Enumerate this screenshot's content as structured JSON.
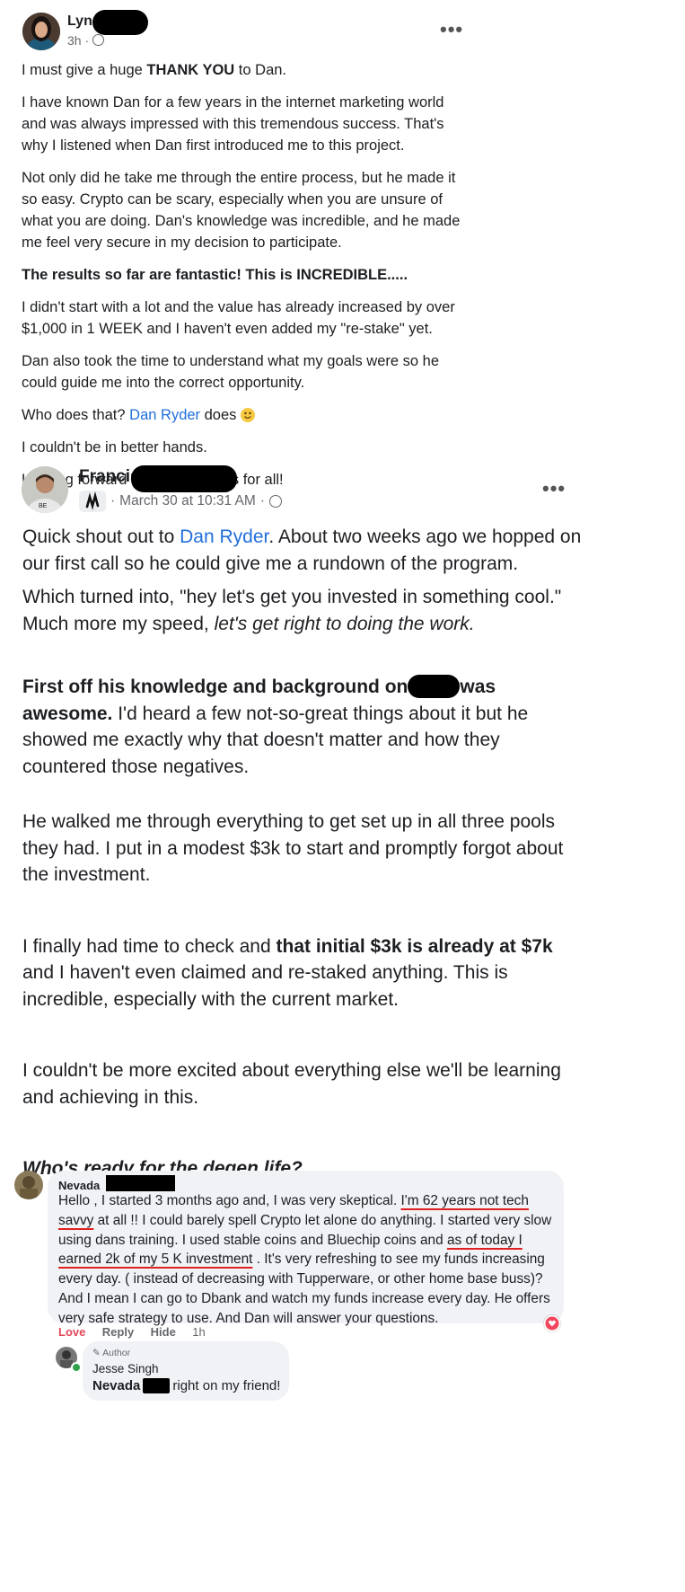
{
  "post1": {
    "author": "Lynn",
    "time": "3h",
    "paragraphs": [
      {
        "pre": "I must give a huge ",
        "bold": "THANK YOU",
        "post": " to Dan."
      },
      {
        "text": "I have known Dan for a few years in the internet marketing world and was always impressed with this tremendous success. That's why I listened when Dan first introduced me to this project."
      },
      {
        "text": "Not only did he take me through the entire process, but he made it so easy. Crypto can be scary, especially when you are unsure of what you are doing. Dan's knowledge was incredible, and he made me feel very secure in my decision to participate."
      },
      {
        "bold": "The results so far are fantastic! This is INCREDIBLE....."
      },
      {
        "text": "I didn't start with a lot and the value has already increased by over $1,000 in 1 WEEK and I haven't even added my \"re-stake\" yet."
      },
      {
        "text": "Dan also took the time to understand what my goals were so he could guide me into the correct opportunity."
      },
      {
        "pre": "Who does that? ",
        "link": "Dan Ryder",
        "post": " does"
      },
      {
        "text": "I couldn't be in better hands."
      },
      {
        "text": "Looking forward to great success for all!"
      }
    ]
  },
  "post2": {
    "author": "Francis",
    "time": "March 30 at 10:31 AM",
    "separator": "·",
    "p1_pre": "Quick shout out to ",
    "p1_link": "Dan Ryder",
    "p1_post": ". About two weeks ago we hopped on our first call so he could give me a rundown of the program.",
    "p2_pre": "Which turned into, \"hey let's get you invested in something cool.\" Much more my speed, ",
    "p2_italic": "let's get right to doing the work.",
    "p3_bold1": "First off his knowledge and background on",
    "p3_bold2": "was awesome.",
    "p3_rest": " I'd heard a few not-so-great things about it but he showed me exactly why that doesn't matter and how they countered those negatives.",
    "p4": "He walked me through everything to get set up in all three pools they had. I put in a modest $3k to start and promptly forgot about the investment.",
    "p5_pre": "I finally had time to check and ",
    "p5_bold": "that initial $3k is already at $7k",
    "p5_post": " and I haven't even claimed and re-staked anything. This is incredible, especially with the current market.",
    "p6": "I couldn't be more excited about everything else we'll be learning and achieving in this.",
    "p7": "Who's ready for the degen life?"
  },
  "comment": {
    "author": "Nevada",
    "t1": "Hello , I started 3 months ago and, I was very skeptical. ",
    "u1": "I'm 62 years not tech savvy",
    "t2": " at all !! I could barely spell Crypto let alone do anything. I started very slow using dans training. I used stable coins and Bluechip coins and ",
    "u2": "as of today I earned 2k of my 5 K investment",
    "t3": " . It's very refreshing to see my funds increasing every day. ( instead of decreasing with Tupperware, or other home base buss)?And I mean I can go to Dbank and watch my funds increase every day. He offers very safe strategy to use. And Dan will answer your questions.",
    "actions": {
      "love": "Love",
      "reply": "Reply",
      "hide": "Hide",
      "time": "1h"
    }
  },
  "reply": {
    "badge": "Author",
    "author": "Jesse Singh",
    "mention": "Nevada",
    "text": "right on my friend!"
  }
}
